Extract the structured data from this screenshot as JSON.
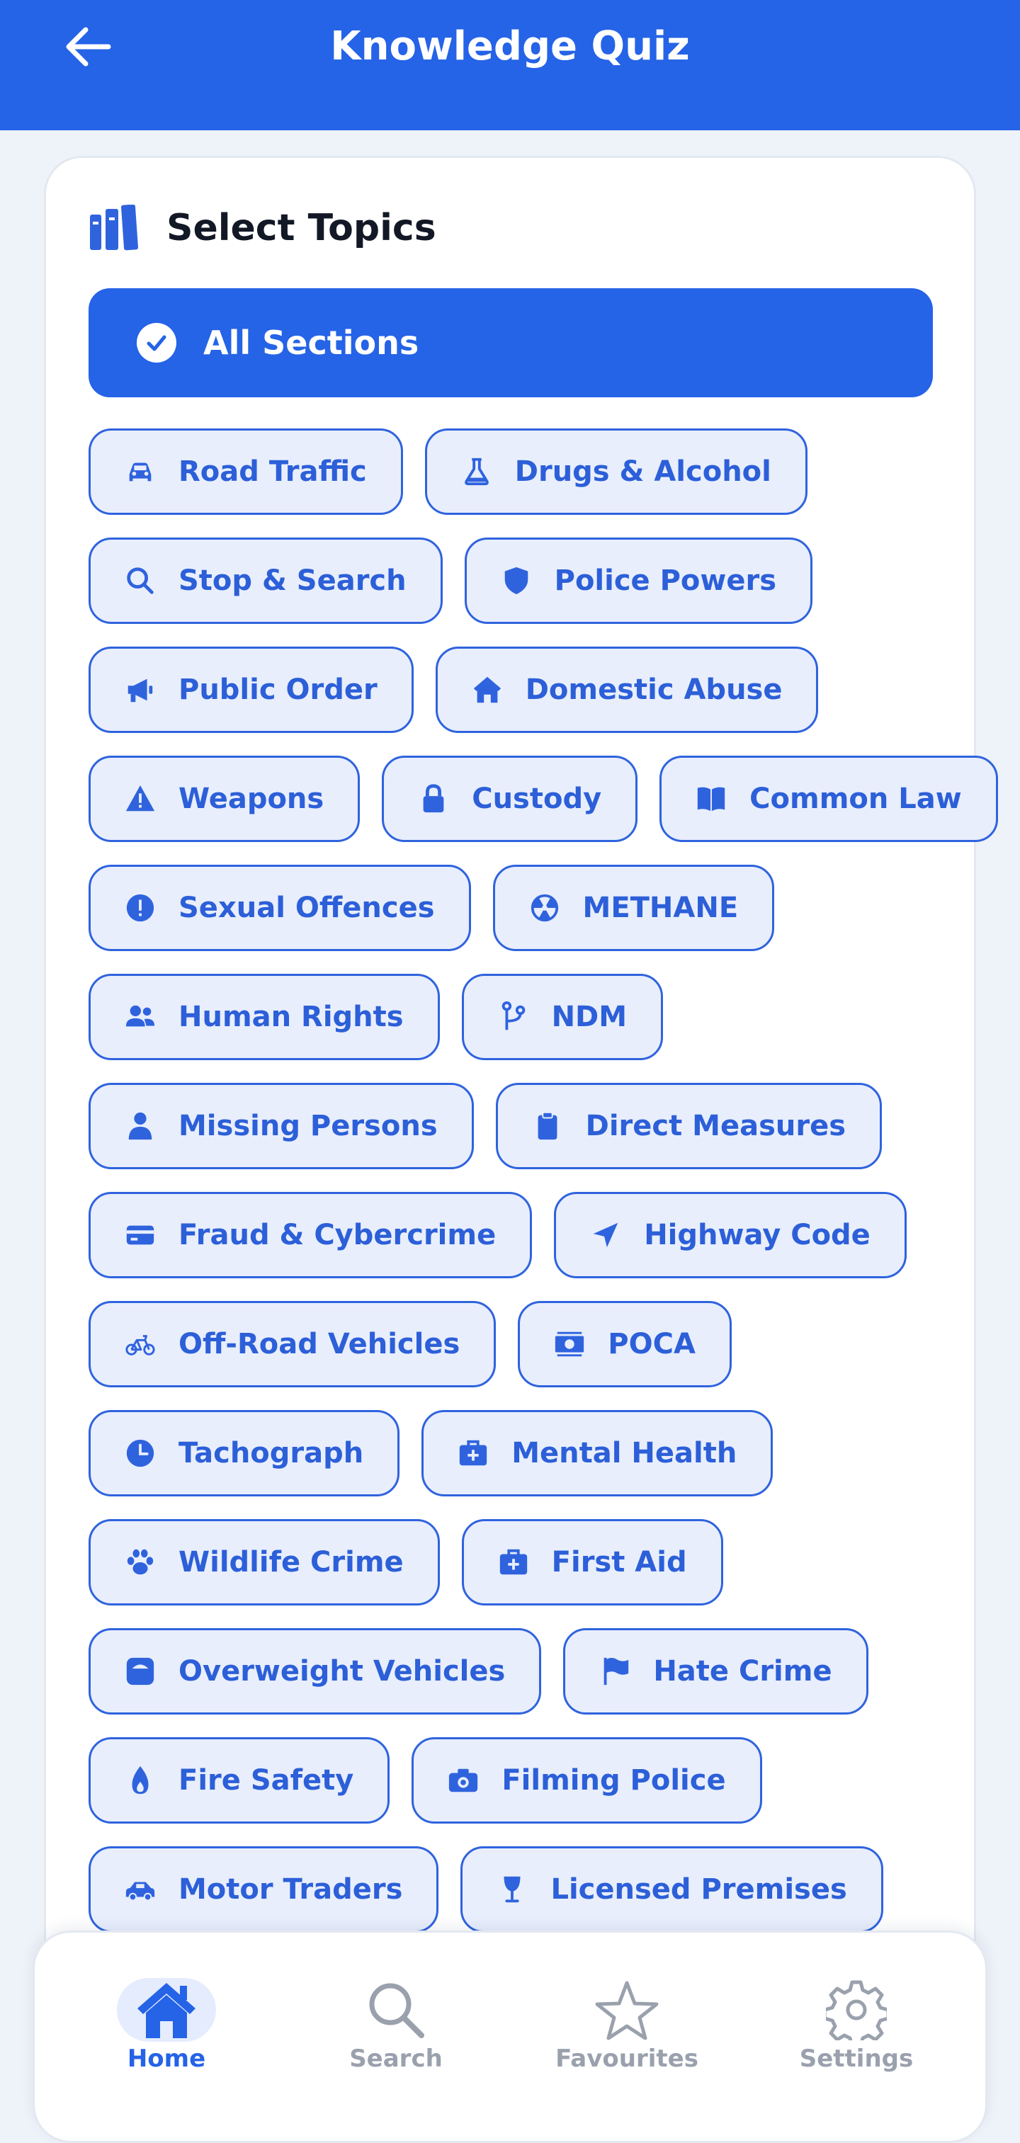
{
  "header": {
    "title": "Knowledge Quiz",
    "back_icon": "arrow-left-icon",
    "background": "#2563e7"
  },
  "topics": {
    "heading": "Select Topics",
    "heading_icon": "books-icon",
    "all_sections": {
      "label": "All Sections",
      "icon": "check-circle-icon",
      "selected": true
    },
    "rows": [
      [
        {
          "label": "Road Traffic",
          "icon": "car-icon"
        },
        {
          "label": "Drugs & Alcohol",
          "icon": "flask-icon"
        }
      ],
      [
        {
          "label": "Stop & Search",
          "icon": "search-icon"
        },
        {
          "label": "Police Powers",
          "icon": "shield-icon"
        }
      ],
      [
        {
          "label": "Public Order",
          "icon": "megaphone-icon"
        },
        {
          "label": "Domestic Abuse",
          "icon": "house-icon"
        }
      ],
      [
        {
          "label": "Weapons",
          "icon": "warning-icon"
        },
        {
          "label": "Custody",
          "icon": "lock-icon"
        },
        {
          "label": "Common Law",
          "icon": "book-icon"
        }
      ],
      [
        {
          "label": "Sexual Offences",
          "icon": "alert-circle-icon"
        },
        {
          "label": "METHANE",
          "icon": "radiation-icon"
        }
      ],
      [
        {
          "label": "Human Rights",
          "icon": "users-icon"
        },
        {
          "label": "NDM",
          "icon": "branch-icon"
        }
      ],
      [
        {
          "label": "Missing Persons",
          "icon": "person-icon"
        },
        {
          "label": "Direct Measures",
          "icon": "clipboard-icon"
        }
      ],
      [
        {
          "label": "Fraud & Cybercrime",
          "icon": "credit-card-icon"
        },
        {
          "label": "Highway Code",
          "icon": "navigation-arrow-icon"
        }
      ],
      [
        {
          "label": "Off-Road Vehicles",
          "icon": "bicycle-icon"
        },
        {
          "label": "POCA",
          "icon": "money-icon"
        }
      ],
      [
        {
          "label": "Tachograph",
          "icon": "clock-icon"
        },
        {
          "label": "Mental Health",
          "icon": "medical-kit-icon"
        }
      ],
      [
        {
          "label": "Wildlife Crime",
          "icon": "paw-icon"
        },
        {
          "label": "First Aid",
          "icon": "first-aid-icon"
        }
      ],
      [
        {
          "label": "Overweight Vehicles",
          "icon": "weight-icon"
        },
        {
          "label": "Hate Crime",
          "icon": "flag-icon"
        }
      ],
      [
        {
          "label": "Fire Safety",
          "icon": "flame-icon"
        },
        {
          "label": "Filming Police",
          "icon": "camera-icon"
        }
      ],
      [
        {
          "label": "Motor Traders",
          "icon": "car-side-icon"
        },
        {
          "label": "Licensed Premises",
          "icon": "wine-glass-icon"
        }
      ]
    ]
  },
  "nav": {
    "items": [
      {
        "label": "Home",
        "icon": "home-icon",
        "active": true
      },
      {
        "label": "Search",
        "icon": "search-icon",
        "active": false
      },
      {
        "label": "Favourites",
        "icon": "star-icon",
        "active": false
      },
      {
        "label": "Settings",
        "icon": "gear-icon",
        "active": false
      }
    ]
  },
  "colors": {
    "accent": "#2563e7",
    "chip_bg": "#e8eefc",
    "chip_text": "#2c5fd8",
    "inactive_nav": "#9aa1ad"
  }
}
